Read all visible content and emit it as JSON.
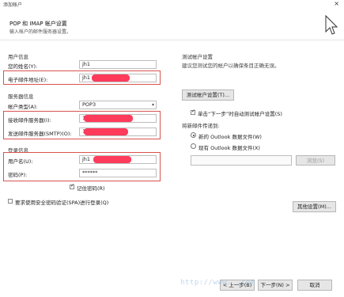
{
  "window": {
    "title": "添加帐户",
    "close_label": "×"
  },
  "header": {
    "title": "POP 和 IMAP 帐户设置",
    "subtitle": "输入帐户的邮件服务器设置。"
  },
  "user_info": {
    "section_label": "用户信息",
    "name_label": "您的姓名(Y):",
    "name_value": "jh1",
    "email_label": "电子邮件地址(E):",
    "email_value": "jh1"
  },
  "server_info": {
    "section_label": "服务器信息",
    "account_type_label": "帐户类型(A):",
    "account_type_value": "POP3",
    "incoming_label": "接收邮件服务器(I):",
    "incoming_value": "1",
    "outgoing_label": "发送邮件服务器(SMTP)(O):",
    "outgoing_value": "1"
  },
  "login_info": {
    "section_label": "登录信息",
    "username_label": "用户名(U):",
    "username_value": "jh1",
    "password_label": "密码(P):",
    "password_value": "******",
    "remember_password_label": "记住密码(R)",
    "remember_password_checked": true
  },
  "spa": {
    "label": "要求使用安全密码验证(SPA)进行登录(Q)",
    "checked": false
  },
  "test_settings": {
    "section_label": "测试帐户设置",
    "description": "建议您测试您的帐户以确保条目正确无误。",
    "test_button": "测试帐户设置(T)...",
    "auto_test_label": "单击“下一步”时自动测试帐户设置(S)",
    "auto_test_checked": true
  },
  "deliver": {
    "section_label": "将新邮件传递到:",
    "option_new": "新的 Outlook 数据文件(W)",
    "option_existing": "现有 Outlook 数据文件(X)",
    "selected": "new",
    "browse_button": "浏览(S)"
  },
  "more_settings_button": "其他设置(M)...",
  "footer": {
    "back_button": "< 上一步(B)",
    "next_button": "下一步(N) >",
    "cancel_button": "取消"
  },
  "watermark": "http://www.  .com",
  "colors": {
    "redact": "#ff3b5c",
    "highlight_box": "#d9534f"
  }
}
